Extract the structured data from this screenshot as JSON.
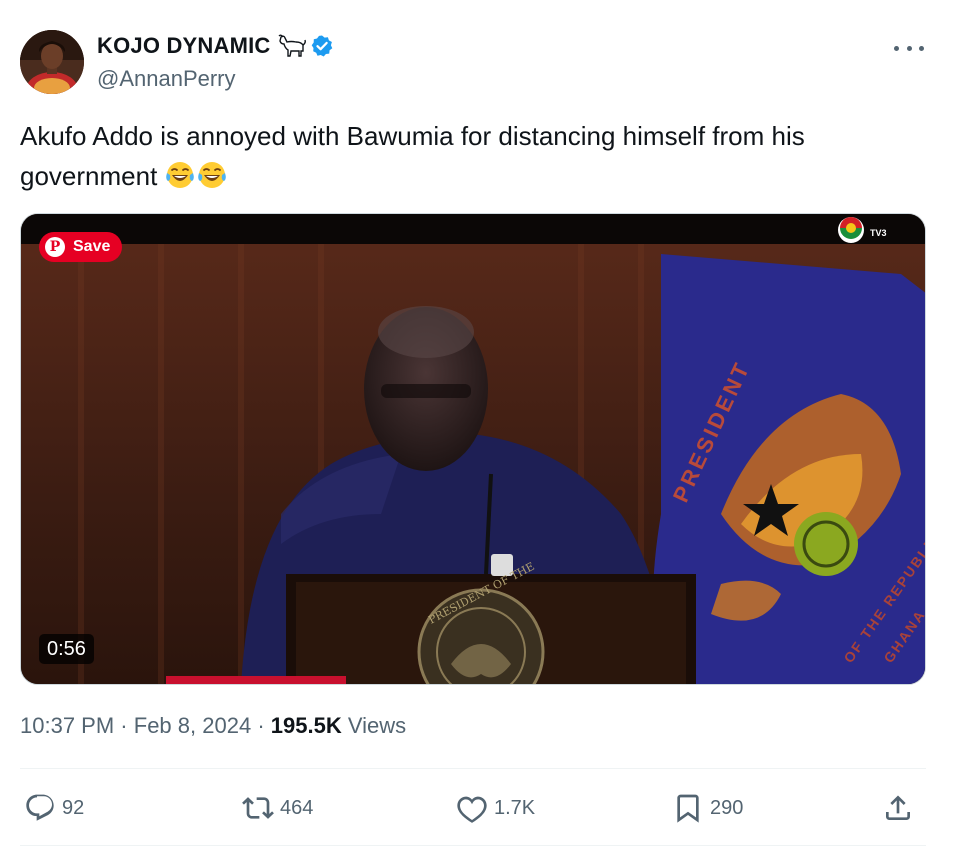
{
  "author": {
    "display_name": "KOJO DYNAMIC",
    "handle": "@AnnanPerry",
    "avatar_icon": "profile-photo",
    "name_emoji_icon": "goat-icon",
    "verified_icon": "verified-badge-icon"
  },
  "tweet": {
    "text": "Akufo Addo is annoyed with Bawumia for distancing himself from his government",
    "emoji": [
      "tears-of-joy-emoji",
      "tears-of-joy-emoji"
    ]
  },
  "media": {
    "type": "video",
    "save_label": "Save",
    "save_pin_glyph": "P",
    "duration": "0:56",
    "channel_logo": "TV3",
    "flag_text": "PRESIDENT",
    "flag_text_2": "OF THE REPUBLIC",
    "flag_text_3": "GHANA",
    "podium_text": "PRESIDENT OF THE"
  },
  "meta": {
    "time": "10:37 PM",
    "separator": "·",
    "date": "Feb 8, 2024",
    "views_count": "195.5K",
    "views_label": "Views"
  },
  "actions": {
    "replies": "92",
    "reposts": "464",
    "likes": "1.7K",
    "bookmarks": "290"
  },
  "colors": {
    "text_primary": "#0f1419",
    "text_secondary": "#536471",
    "verified_blue": "#1d9bf0",
    "pinterest_red": "#e60023"
  }
}
